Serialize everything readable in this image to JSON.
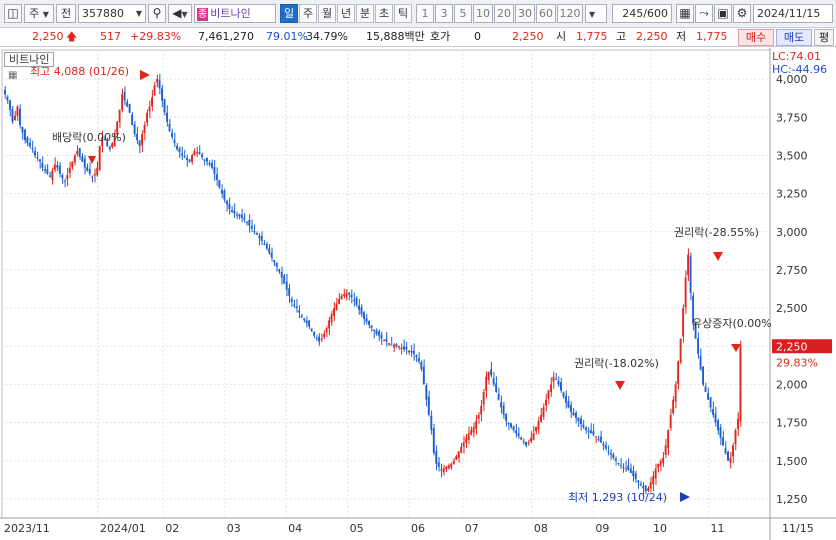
{
  "toolbar": {
    "market_label": "주",
    "prev_label": "전",
    "stock_code": "357880",
    "search_icon": "magnifier-icon",
    "stock_tag": "종",
    "stock_name": "비트나인",
    "periods": [
      "일",
      "주",
      "월",
      "년",
      "분",
      "초",
      "틱"
    ],
    "active_period": "일",
    "numbers": [
      "1",
      "3",
      "5",
      "10",
      "20",
      "30",
      "60",
      "120"
    ],
    "count_value": "245",
    "count_total": "/600",
    "date": "2024/11/15"
  },
  "info": {
    "price": "2,250",
    "change": "517",
    "change_pct": "+29.83%",
    "volume": "7,461,270",
    "vol_ratio": "79.01%",
    "turnover": "34.79%",
    "amount": "15,888백만",
    "hoga_label": "호가",
    "hoga_value": "0",
    "price2": "2,250",
    "open_label": "시",
    "open": "1,775",
    "high_label": "고",
    "high": "2,250",
    "low_label": "저",
    "low": "1,775",
    "buy_label": "매수",
    "sell_label": "매도",
    "eval_label": "평"
  },
  "chart_data": {
    "type": "candlestick",
    "title": "비트나인",
    "indicators": {
      "lc": "LC:74.01",
      "hc": "HC:-44.96"
    },
    "y_ticks": [
      "4,000",
      "3,750",
      "3,500",
      "3,250",
      "3,000",
      "2,750",
      "2,500",
      "2,250",
      "2,000",
      "1,750",
      "1,500",
      "1,250"
    ],
    "ylim": [
      1125,
      4125
    ],
    "x_ticks": [
      "2023/11",
      "2024/01",
      "02",
      "03",
      "04",
      "05",
      "06",
      "07",
      "08",
      "09",
      "10",
      "11",
      "11/15"
    ],
    "current_price_label": "2,250",
    "current_pct_label": "29.83%",
    "annotations": {
      "high": "최고 4,088 (01/26)",
      "low": "최저 1,293 (10/24)",
      "dividend": "배당락(0.00%)",
      "rights1": "권리락(-18.02%)",
      "rights2": "권리락(-28.55%)",
      "capital": "유상증자(0.00%"
    },
    "closes": [
      3900,
      3860,
      3800,
      3720,
      3760,
      3820,
      3700,
      3650,
      3600,
      3580,
      3560,
      3540,
      3500,
      3480,
      3460,
      3420,
      3400,
      3380,
      3360,
      3400,
      3440,
      3420,
      3380,
      3350,
      3330,
      3370,
      3420,
      3460,
      3500,
      3530,
      3490,
      3460,
      3420,
      3400,
      3380,
      3360,
      3380,
      3420,
      3560,
      3620,
      3600,
      3560,
      3540,
      3580,
      3640,
      3720,
      3800,
      3900,
      3860,
      3820,
      3780,
      3700,
      3640,
      3600,
      3560,
      3640,
      3700,
      3780,
      3820,
      3880,
      3960,
      4000,
      3940,
      3860,
      3780,
      3720,
      3660,
      3620,
      3580,
      3540,
      3520,
      3500,
      3490,
      3470,
      3460,
      3500,
      3530,
      3520,
      3510,
      3490,
      3470,
      3460,
      3440,
      3420,
      3380,
      3340,
      3290,
      3250,
      3210,
      3180,
      3150,
      3130,
      3120,
      3110,
      3100,
      3090,
      3080,
      3060,
      3040,
      3020,
      3000,
      2980,
      2960,
      2940,
      2920,
      2890,
      2860,
      2830,
      2800,
      2770,
      2740,
      2700,
      2660,
      2620,
      2580,
      2540,
      2520,
      2500,
      2470,
      2440,
      2420,
      2400,
      2380,
      2350,
      2320,
      2300,
      2280,
      2300,
      2330,
      2370,
      2420,
      2460,
      2500,
      2530,
      2560,
      2580,
      2590,
      2600,
      2590,
      2570,
      2550,
      2520,
      2490,
      2460,
      2430,
      2410,
      2390,
      2370,
      2350,
      2330,
      2320,
      2300,
      2290,
      2280,
      2270,
      2260,
      2260,
      2250,
      2250,
      2240,
      2230,
      2230,
      2220,
      2210,
      2200,
      2180,
      2150,
      2100,
      2000,
      1900,
      1800,
      1700,
      1550,
      1480,
      1460,
      1440,
      1450,
      1460,
      1470,
      1480,
      1500,
      1530,
      1560,
      1590,
      1620,
      1650,
      1680,
      1700,
      1720,
      1760,
      1800,
      1860,
      1950,
      2050,
      2080,
      2060,
      2000,
      1950,
      1900,
      1850,
      1800,
      1760,
      1740,
      1720,
      1700,
      1680,
      1660,
      1640,
      1620,
      1600,
      1620,
      1650,
      1680,
      1720,
      1760,
      1800,
      1850,
      1900,
      1960,
      2000,
      2050,
      2030,
      2000,
      1960,
      1920,
      1880,
      1850,
      1820,
      1800,
      1780,
      1760,
      1740,
      1720,
      1700,
      1690,
      1680,
      1670,
      1660,
      1640,
      1620,
      1600,
      1580,
      1560,
      1540,
      1520,
      1500,
      1480,
      1470,
      1460,
      1450,
      1440,
      1420,
      1400,
      1380,
      1360,
      1340,
      1320,
      1300,
      1320,
      1360,
      1400,
      1450,
      1480,
      1500,
      1520,
      1600,
      1700,
      1800,
      1900,
      2000,
      2150,
      2300,
      2500,
      2700,
      2850,
      2600,
      2400,
      2300,
      2200,
      2100,
      2000,
      1950,
      1900,
      1850,
      1800,
      1750,
      1700,
      1650,
      1600,
      1550,
      1500,
      1520,
      1600,
      1700,
      1775,
      2250
    ]
  }
}
